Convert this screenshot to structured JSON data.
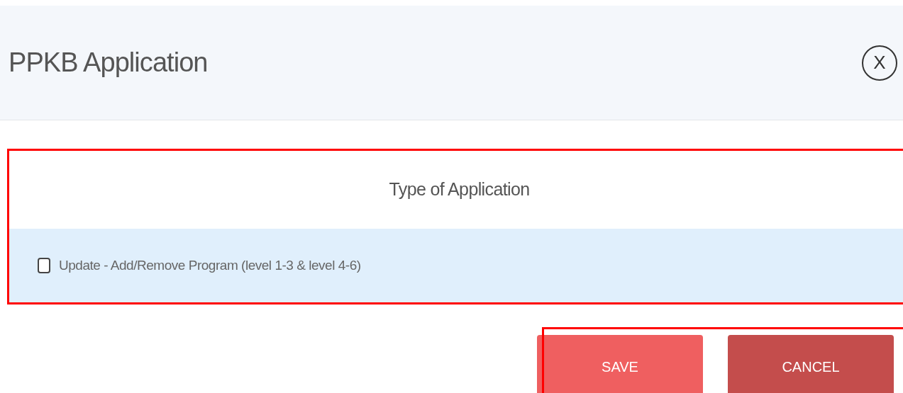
{
  "dialog": {
    "title": "PPKB Application",
    "close_label": "X"
  },
  "section": {
    "heading": "Type of Application",
    "options": [
      {
        "label": "Update - Add/Remove Program (level 1-3 & level 4-6)",
        "checked": false
      }
    ]
  },
  "buttons": [
    {
      "label": "SAVE",
      "kind": "primary"
    },
    {
      "label": "CANCEL",
      "kind": "secondary"
    }
  ]
}
